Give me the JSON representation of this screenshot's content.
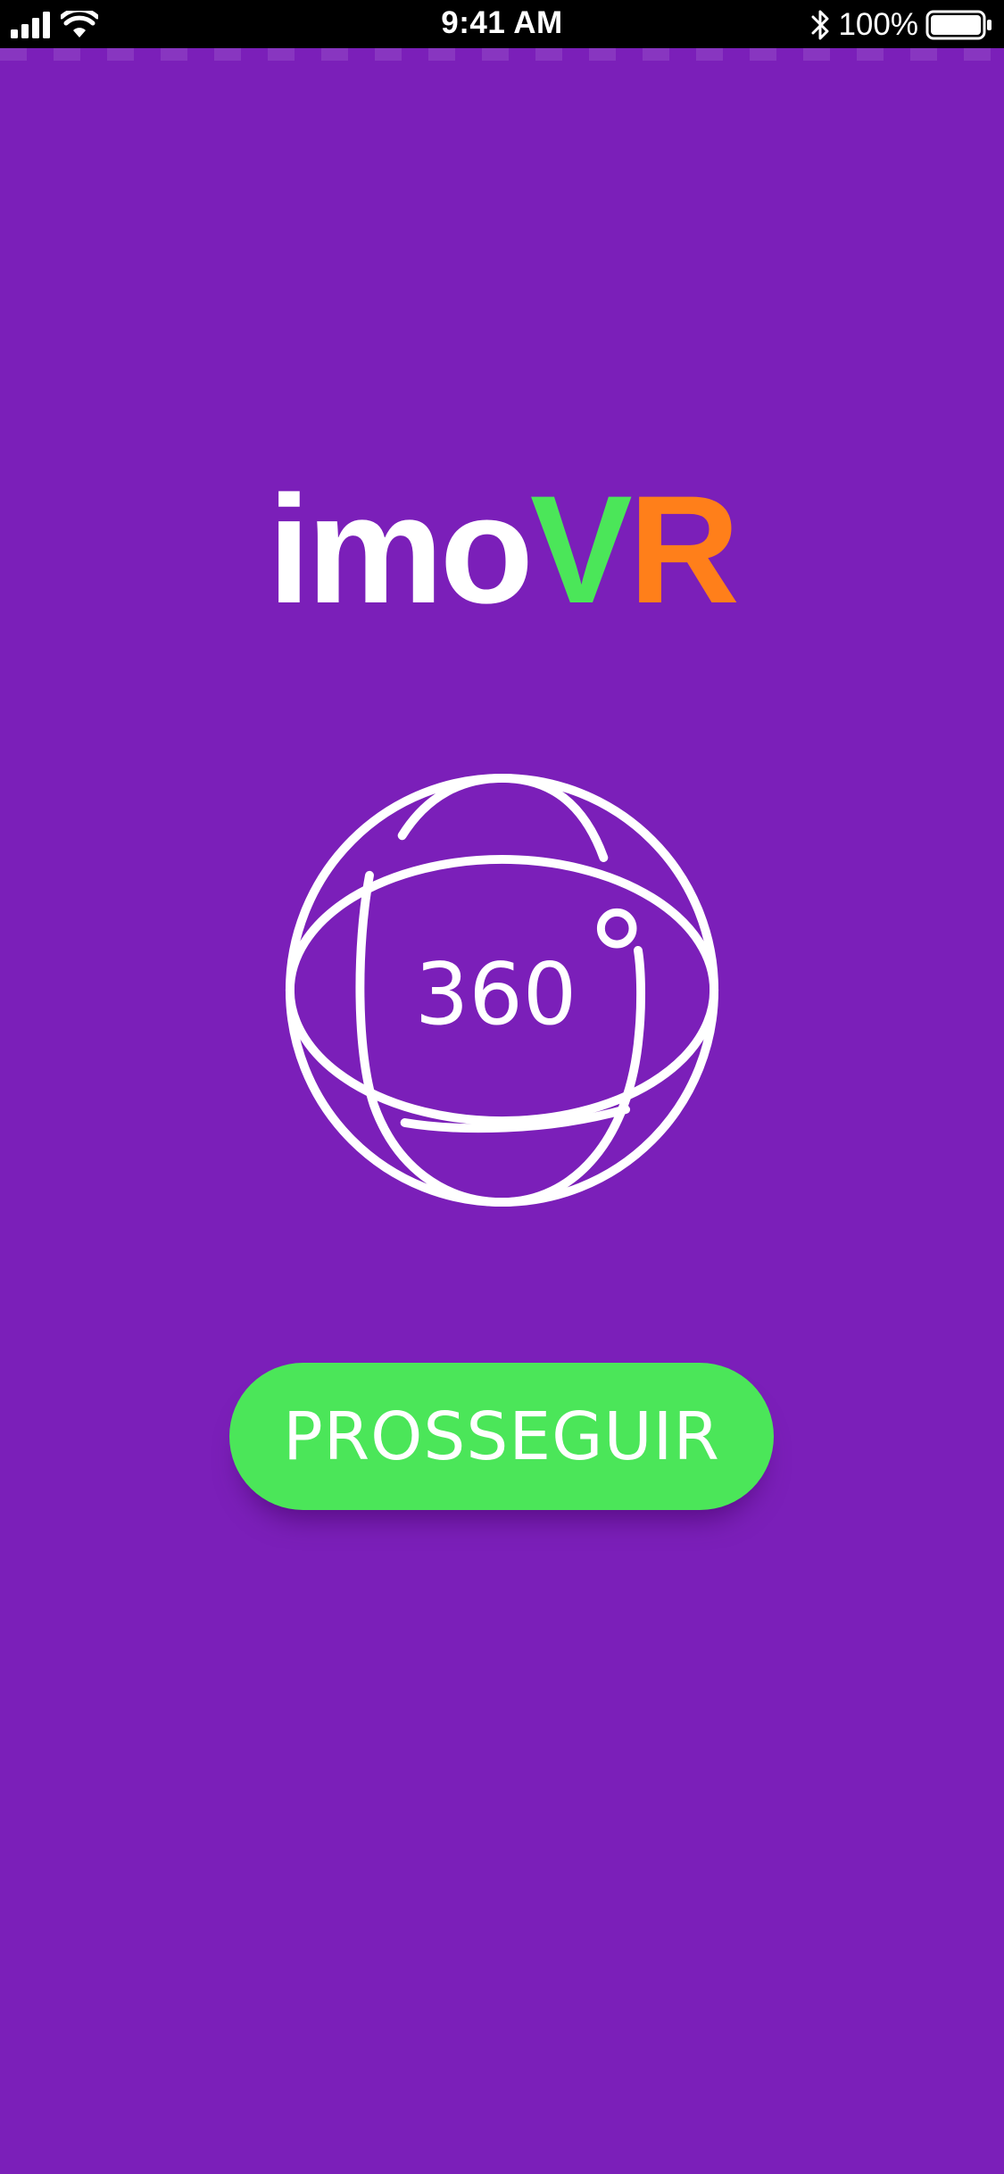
{
  "status_bar": {
    "time": "9:41 AM",
    "battery": "100%",
    "icons": [
      "signal-icon",
      "wifi-icon",
      "bluetooth-icon",
      "battery-icon"
    ]
  },
  "logo": {
    "part1": "imo",
    "part2": "V",
    "part3": "R",
    "colors": {
      "part1": "#ffffff",
      "part2": "#4be659",
      "part3": "#ff7f1a"
    }
  },
  "globe": {
    "icon": "globe-360-icon",
    "label": "360",
    "degree_icon": "degree-icon"
  },
  "proceed_button": {
    "label": "PROSSEGUIR"
  },
  "colors": {
    "background": "#7b1fb9",
    "button": "#4be659",
    "status_bar": "#000000"
  }
}
